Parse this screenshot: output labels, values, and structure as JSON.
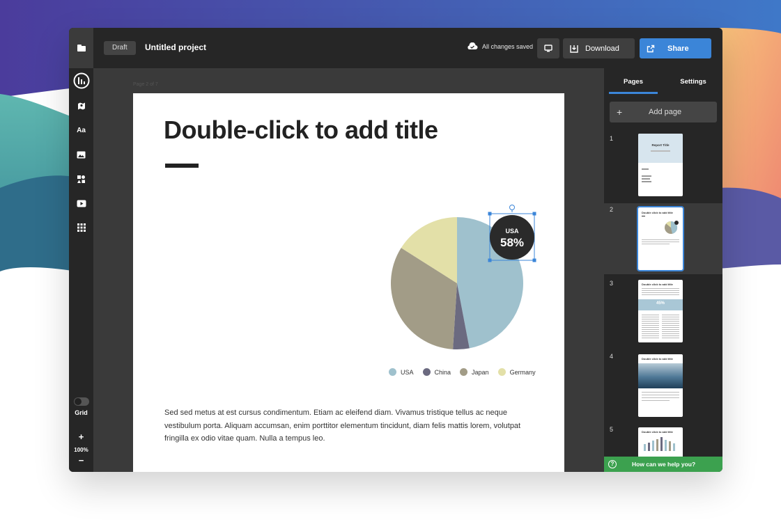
{
  "topbar": {
    "draft_label": "Draft",
    "project_title": "Untitled project",
    "saved_status": "All changes saved",
    "download_label": "Download",
    "share_label": "Share"
  },
  "lefttools": {
    "text_tool_label": "Aa",
    "grid_label": "Grid",
    "zoom_plus": "+",
    "zoom_value": "100%",
    "zoom_minus": "−"
  },
  "canvas": {
    "page_indicator": "Page 2 of 7",
    "doc_title": "Double-click to add title",
    "body_text": "Sed sed metus at est cursus condimentum. Etiam ac eleifend diam. Vivamus tristique tellus ac neque vestibulum porta. Aliquam accumsan, enim porttitor elementum tincidunt, diam felis mattis lorem, volutpat fringilla ex odio vitae quam. Nulla a tempus leo.",
    "callout_label": "USA",
    "callout_value": "58%"
  },
  "chart_data": {
    "type": "pie",
    "categories": [
      "USA",
      "China",
      "Japan",
      "Germany"
    ],
    "values": [
      47,
      4,
      33,
      16
    ],
    "colors": [
      "#9fc1cd",
      "#6b6a80",
      "#a29c87",
      "#e3e0a8"
    ],
    "legend_position": "bottom"
  },
  "rightpanel": {
    "tab_pages": "Pages",
    "tab_settings": "Settings",
    "add_page_icon": "+",
    "add_page_label": "Add page",
    "pages": [
      {
        "num": "1",
        "title": "Report Title"
      },
      {
        "num": "2",
        "title": "Double click to add title"
      },
      {
        "num": "3",
        "title": "Double click to add title",
        "stat": "45%"
      },
      {
        "num": "4",
        "title": "Double click to add title"
      },
      {
        "num": "5",
        "title": "Double click to add title"
      }
    ],
    "help_icon": "?",
    "help_label": "How can we help you?"
  }
}
